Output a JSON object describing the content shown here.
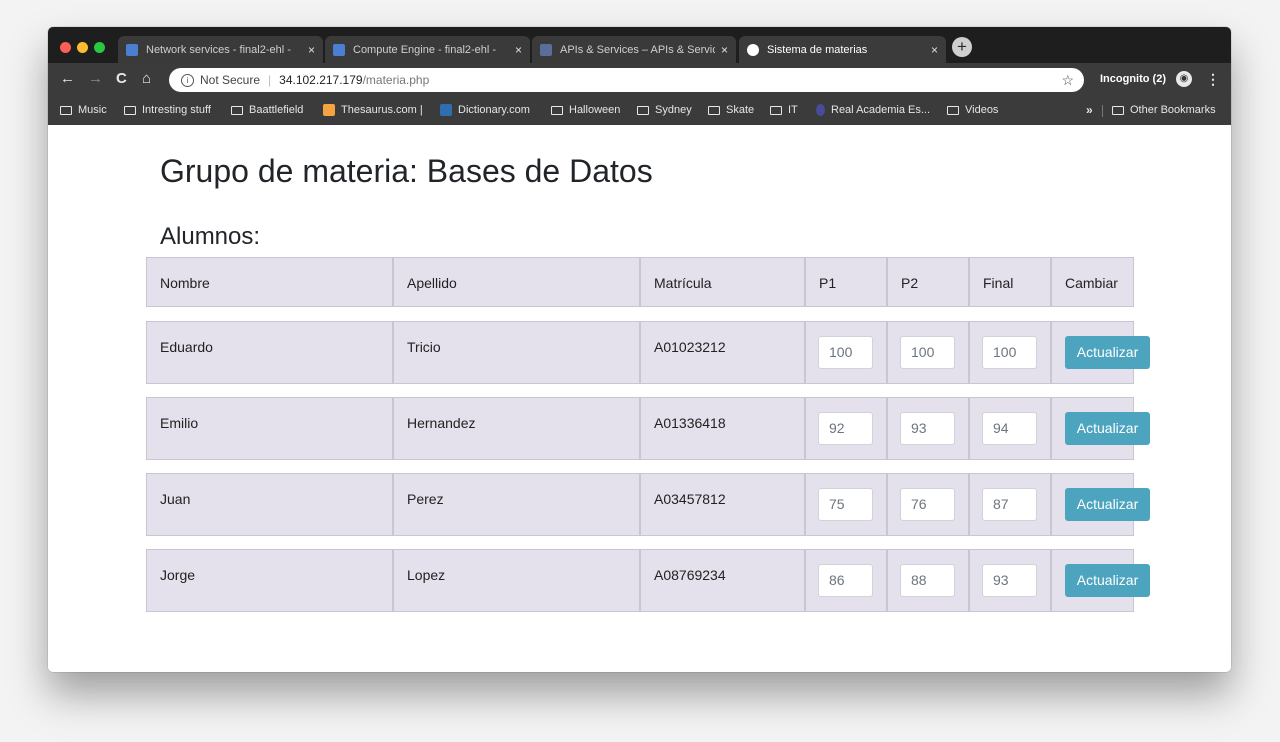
{
  "browser": {
    "tabs": [
      {
        "title": "Network services - final2-ehl -",
        "icon_color": "#4a7fd1",
        "active": false
      },
      {
        "title": "Compute Engine - final2-ehl -",
        "icon_color": "#4a7fd1",
        "active": false
      },
      {
        "title": "APIs & Services – APIs & Servic",
        "icon_color": "#5b6e9a",
        "active": false
      },
      {
        "title": "Sistema de materias",
        "icon_color": "#ffffff",
        "active": true
      }
    ],
    "tab_close_glyph": "×",
    "new_tab_glyph": "+",
    "address": {
      "security_label": "Not Secure",
      "host": "34.102.217.179",
      "path": "/materia.php"
    },
    "incognito_label": "Incognito (2)",
    "bookmarks": [
      {
        "label": "Music",
        "icon": "folder-icon"
      },
      {
        "label": "Intresting stuff",
        "icon": "folder-icon"
      },
      {
        "label": "Baattlefield",
        "icon": "folder-icon"
      },
      {
        "label": "Thesaurus.com |",
        "icon": "thesaurus-icon"
      },
      {
        "label": "Dictionary.com",
        "icon": "dictionary-icon"
      },
      {
        "label": "Halloween",
        "icon": "folder-icon"
      },
      {
        "label": "Sydney",
        "icon": "folder-icon"
      },
      {
        "label": "Skate",
        "icon": "folder-icon"
      },
      {
        "label": "IT",
        "icon": "folder-icon"
      },
      {
        "label": "Real Academia Es...",
        "icon": "rae-icon"
      },
      {
        "label": "Videos",
        "icon": "folder-icon"
      }
    ],
    "overflow_label": "»",
    "other_bookmarks": "Other Bookmarks"
  },
  "page": {
    "title": "Grupo de materia: Bases de Datos",
    "section": "Alumnos:",
    "columns": [
      "Nombre",
      "Apellido",
      "Matrícula",
      "P1",
      "P2",
      "Final",
      "Cambiar"
    ],
    "students": [
      {
        "nombre": "Eduardo",
        "apellido": "Tricio",
        "matricula": "A01023212",
        "p1": "100",
        "p2": "100",
        "final": "100",
        "action": "Actualizar"
      },
      {
        "nombre": "Emilio",
        "apellido": "Hernandez",
        "matricula": "A01336418",
        "p1": "92",
        "p2": "93",
        "final": "94",
        "action": "Actualizar"
      },
      {
        "nombre": "Juan",
        "apellido": "Perez",
        "matricula": "A03457812",
        "p1": "75",
        "p2": "76",
        "final": "87",
        "action": "Actualizar"
      },
      {
        "nombre": "Jorge",
        "apellido": "Lopez",
        "matricula": "A08769234",
        "p1": "86",
        "p2": "88",
        "final": "93",
        "action": "Actualizar"
      }
    ]
  },
  "colors": {
    "row_bg": "#e4e1ec",
    "button_bg": "#4da4bf",
    "chrome_dark": "#3b3b3b"
  }
}
